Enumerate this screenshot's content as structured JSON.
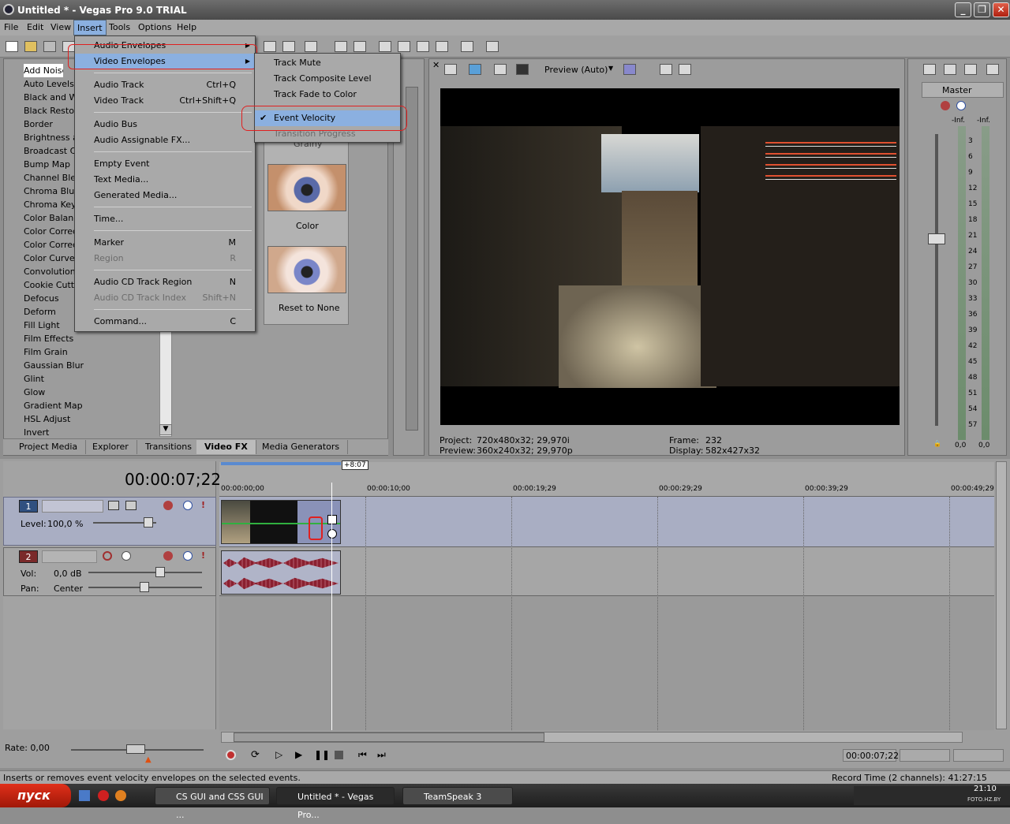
{
  "window": {
    "title": "Untitled * - Vegas Pro 9.0 TRIAL"
  },
  "menubar": [
    "File",
    "Edit",
    "View",
    "Insert",
    "Tools",
    "Options",
    "Help"
  ],
  "fx_panel": {
    "items": [
      "Add Noise",
      "Auto Levels",
      "Black and White",
      "Black Restore",
      "Border",
      "Brightness and Contrast",
      "Broadcast Colors",
      "Bump Map",
      "Channel Blend",
      "Chroma Blur",
      "Chroma Keyer",
      "Color Balance",
      "Color Corrector",
      "Color Corrector (Secondary)",
      "Color Curves",
      "Convolution Kernel",
      "Cookie Cutter",
      "Defocus",
      "Deform",
      "Fill Light",
      "Film Effects",
      "Film Grain",
      "Gaussian Blur",
      "Glint",
      "Glow",
      "Gradient Map",
      "HSL Adjust",
      "Invert"
    ],
    "selected": "Add Noise",
    "presets": [
      "Grainy",
      "Color",
      "Reset to None"
    ]
  },
  "tabs": [
    "Project Media",
    "Explorer",
    "Transitions",
    "Video FX",
    "Media Generators"
  ],
  "active_tab": "Video FX",
  "insert_menu": {
    "items": [
      {
        "label": "Audio Envelopes",
        "shortcut": "",
        "arrow": true
      },
      {
        "label": "Video Envelopes",
        "shortcut": "",
        "arrow": true,
        "selected": true
      },
      {
        "label": "Audio Track",
        "shortcut": "Ctrl+Q"
      },
      {
        "label": "Video Track",
        "shortcut": "Ctrl+Shift+Q"
      },
      {
        "label": "Audio Bus",
        "shortcut": ""
      },
      {
        "label": "Audio Assignable FX...",
        "shortcut": ""
      },
      {
        "label": "Empty Event",
        "shortcut": ""
      },
      {
        "label": "Text Media...",
        "shortcut": ""
      },
      {
        "label": "Generated Media...",
        "shortcut": ""
      },
      {
        "label": "Time...",
        "shortcut": ""
      },
      {
        "label": "Marker",
        "shortcut": "M"
      },
      {
        "label": "Region",
        "shortcut": "R",
        "disabled": true
      },
      {
        "label": "Audio CD Track Region",
        "shortcut": "N"
      },
      {
        "label": "Audio CD Track Index",
        "shortcut": "Shift+N",
        "disabled": true
      },
      {
        "label": "Command...",
        "shortcut": "C"
      }
    ]
  },
  "video_env_menu": {
    "items": [
      {
        "label": "Track Mute"
      },
      {
        "label": "Track Composite Level"
      },
      {
        "label": "Track Fade to Color"
      },
      {
        "label": "Event Velocity",
        "checked": true,
        "selected": true
      },
      {
        "label": "Transition Progress",
        "disabled": true
      }
    ]
  },
  "preview": {
    "mode": "Preview (Auto)",
    "project_label": "Project:",
    "project_value": "720x480x32; 29,970i",
    "preview_label": "Preview:",
    "preview_value": "360x240x32; 29,970p",
    "frame_label": "Frame:",
    "frame_value": "232",
    "display_label": "Display:",
    "display_value": "582x427x32"
  },
  "master": {
    "label": "Master",
    "peak_l": "-Inf.",
    "peak_r": "-Inf.",
    "scale": [
      "3",
      "6",
      "9",
      "12",
      "15",
      "18",
      "21",
      "24",
      "27",
      "30",
      "33",
      "36",
      "39",
      "42",
      "45",
      "48",
      "51",
      "54",
      "57"
    ],
    "val_l": "0,0",
    "val_r": "0,0"
  },
  "timeline": {
    "timecode": "00:00:07;22",
    "marker_offset": "+8:07",
    "ruler": [
      "00:00:00;00",
      "00:00:10;00",
      "00:00:19;29",
      "00:00:29;29",
      "00:00:39;29",
      "00:00:49;29"
    ],
    "playhead_fraction": 0.145
  },
  "tracks": [
    {
      "num": "1",
      "level_label": "Level:",
      "level": "100,0 %"
    },
    {
      "num": "2",
      "vol_label": "Vol:",
      "vol": "0,0 dB",
      "pan_label": "Pan:",
      "pan": "Center"
    }
  ],
  "rate": "Rate: 0,00",
  "transport_time": "00:00:07;22",
  "status": {
    "message": "Inserts or removes event velocity envelopes on the selected events.",
    "record": "Record Time (2 channels): 41:27:15"
  },
  "taskbar": {
    "start": "пуск",
    "tasks": [
      "CS GUI and CSS GUI ...",
      "Untitled * - Vegas Pro...",
      "TeamSpeak 3"
    ],
    "clock": "21:10",
    "watermark": "FOTO.HZ.BY"
  }
}
